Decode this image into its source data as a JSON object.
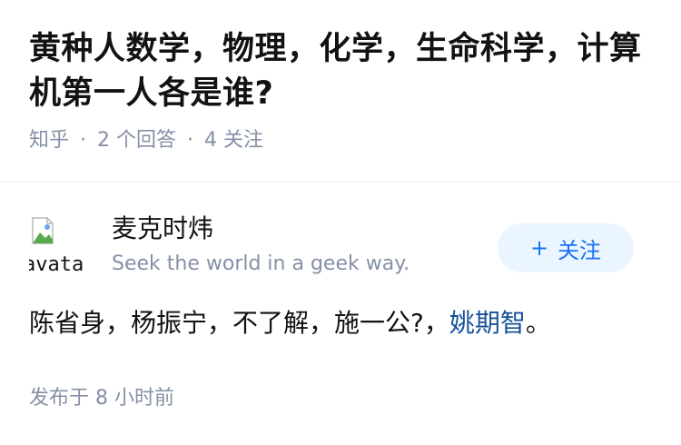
{
  "question": {
    "title": "黄种人数学，物理，化学，生命科学，计算机第一人各是谁?",
    "source": "知乎",
    "separator": "·",
    "answers_count": "2 个回答",
    "followers_count": "4 关注"
  },
  "answer": {
    "avatar_alt": "avatar",
    "author_name": "麦克时炜",
    "author_bio": "Seek the world in a geek way.",
    "follow_button": {
      "icon": "+",
      "label": "关注"
    },
    "content_text": "陈省身，杨振宁，不了解，施一公?，",
    "content_link": "姚期智",
    "content_end": "。",
    "published": "发布于 8 小时前"
  },
  "colors": {
    "meta_gray": "#8590a6",
    "accent_blue": "#1772f6",
    "link_blue": "#175199",
    "button_bg": "#ebf5ff"
  }
}
